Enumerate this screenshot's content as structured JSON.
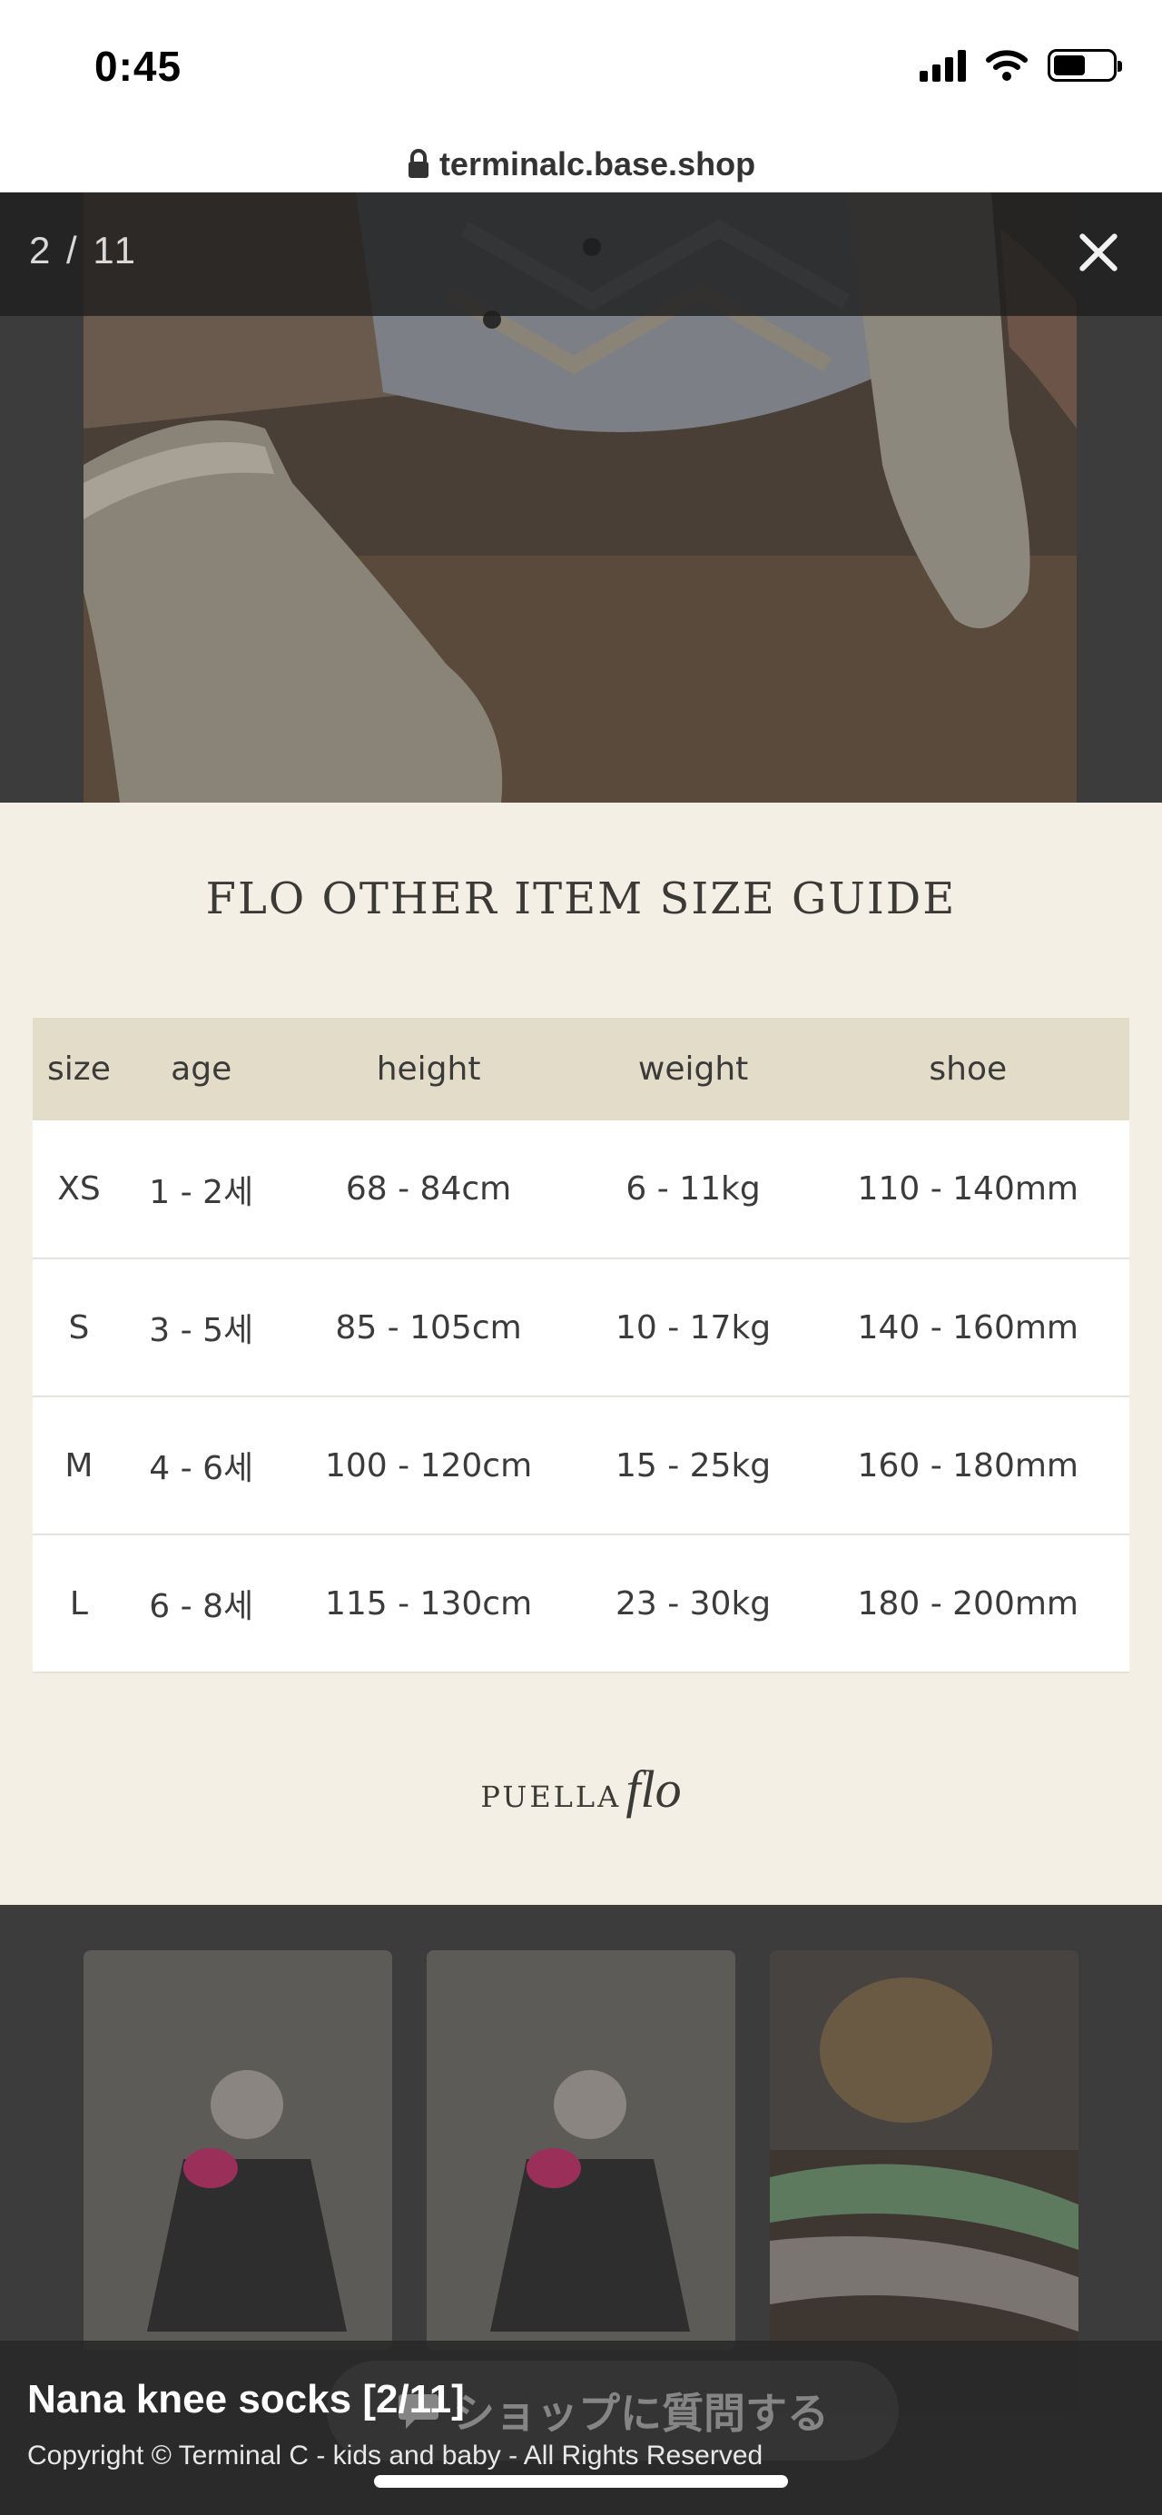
{
  "status_bar": {
    "time": "0:45",
    "signal_icon": "cellular-signal-icon",
    "wifi_icon": "wifi-icon",
    "battery_icon": "battery-icon"
  },
  "browser": {
    "url": "terminalc.base.shop",
    "lock_icon": "lock-icon"
  },
  "lightbox": {
    "counter": "2 / 11",
    "close_icon": "close-icon",
    "size_guide": {
      "title": "FLO OTHER ITEM SIZE GUIDE",
      "headers": [
        "size",
        "age",
        "height",
        "weight",
        "shoe"
      ],
      "rows": [
        [
          "XS",
          "1 - 2세",
          "68 - 84cm",
          "6 - 11kg",
          "110 - 140mm"
        ],
        [
          "S",
          "3 - 5세",
          "85 - 105cm",
          "10 - 17kg",
          "140 - 160mm"
        ],
        [
          "M",
          "4 - 6세",
          "100 - 120cm",
          "15 - 25kg",
          "160 - 180mm"
        ],
        [
          "L",
          "6 - 8세",
          "115 - 130cm",
          "23 - 30kg",
          "180 - 200mm"
        ]
      ],
      "logo": {
        "word1": "PUELLA",
        "word2": "flo"
      }
    }
  },
  "caption": {
    "title": "Nana knee socks [2/11]",
    "copyright": "Copyright © Terminal C - kids and baby - All Rights Reserved"
  },
  "ask_button": {
    "label": "ショップに質問する",
    "icon": "chat-bubble-icon"
  }
}
